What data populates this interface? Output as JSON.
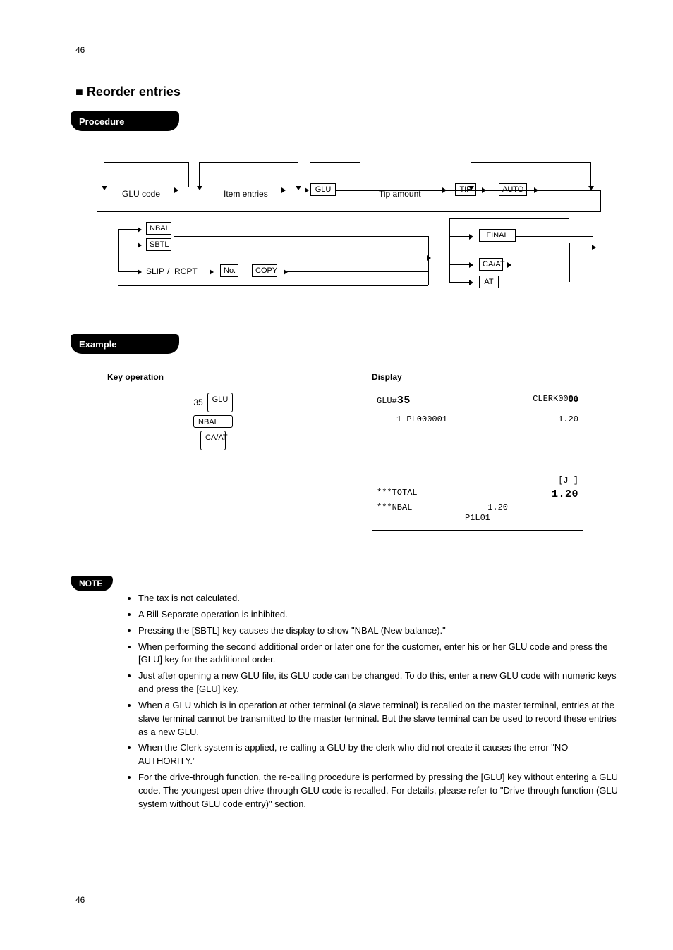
{
  "page_num_top": "46",
  "title": "■ Reorder entries",
  "tabs": {
    "procedure": "Procedure",
    "example": "Example",
    "note": "NOTE"
  },
  "diagram": {
    "row1": {
      "glu_label": "GLU code",
      "glu": "GLU",
      "item_entries": "Item entries",
      "tip_label": "Tip amount",
      "tip": " TIP ",
      "auto": "AUTO"
    },
    "row1b": {
      "nbal": "NBAL",
      "sbtl": "SBTL",
      "final": "FINAL"
    },
    "row2": {
      "slip": "SLIP",
      "rcpt": "RCPT",
      "no": "No.",
      "copy": "COPY",
      "cash": "CA/AT",
      "at": "AT"
    }
  },
  "example": {
    "key_header": "Key operation",
    "display_header": "Display",
    "keys": {
      "n35": "35",
      "glu": "GLU",
      "nbal": "NBAL",
      "cash": "CA/AT"
    }
  },
  "display": {
    "line_glu": "GLU#35",
    "clerk": "CLERK0001",
    "corner": "00",
    "item_line_l": "1 PL000001",
    "item_line_r": "1.20",
    "j": "[J ]",
    "total_l": "***TOTAL",
    "total_r": "1.20",
    "nbal_l": "***NBAL",
    "nbal_r": "1.20",
    "bottom": "P1L01"
  },
  "notes": [
    "The tax is not calculated.",
    "A Bill Separate operation is inhibited.",
    "Pressing the [SBTL] key causes the display to show \"NBAL (New balance).\"",
    "When performing the second additional order or later one for the customer, enter his or her GLU code and press the [GLU] key for the additional order.",
    "Just after opening a new GLU file, its GLU code can be changed. To do this, enter a new GLU code with numeric keys and press the [GLU] key.",
    "When a GLU which is in operation at other terminal (a slave terminal) is recalled on the master terminal, entries at the slave terminal cannot be transmitted to the master terminal. But the slave terminal can be used to record these entries as a new GLU.",
    "When the Clerk system is applied, re-calling a GLU by the clerk who did not create it causes the error \"NO AUTHORITY.\"",
    "For the drive-through function, the re-calling procedure is performed by pressing the [GLU] key without entering a GLU code. The youngest open drive-through GLU code is recalled. For details, please refer to \"Drive-through function (GLU system without GLU code entry)\" section."
  ],
  "page_num_bottom": "46"
}
